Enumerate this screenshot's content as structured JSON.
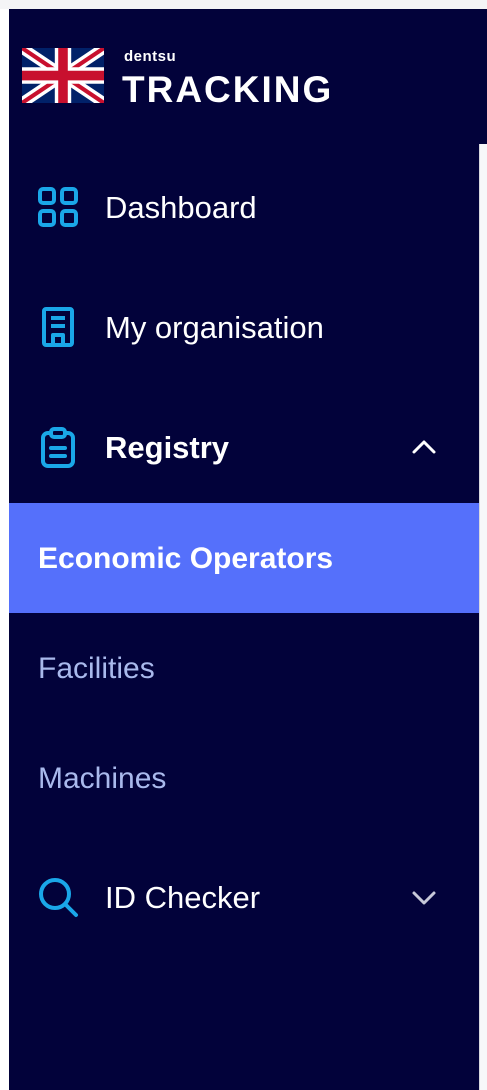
{
  "brand": {
    "company": "dentsu",
    "product": "TRACKING",
    "flag_icon": "uk-flag-icon"
  },
  "nav": {
    "dashboard": {
      "label": "Dashboard",
      "icon": "dashboard-grid-icon"
    },
    "organisation": {
      "label": "My organisation",
      "icon": "building-icon"
    },
    "registry": {
      "label": "Registry",
      "icon": "clipboard-icon",
      "expanded": true,
      "chevron": "chevron-up-icon",
      "children": [
        {
          "label": "Economic Operators",
          "active": true
        },
        {
          "label": "Facilities",
          "active": false
        },
        {
          "label": "Machines",
          "active": false
        }
      ]
    },
    "id_checker": {
      "label": "ID Checker",
      "icon": "search-icon",
      "expanded": false,
      "chevron": "chevron-down-icon"
    }
  },
  "colors": {
    "sidebar_bg": "#02023a",
    "accent_icon": "#1aa7e8",
    "active_bg": "#5570fb",
    "sub_text": "#a9b9ec"
  }
}
